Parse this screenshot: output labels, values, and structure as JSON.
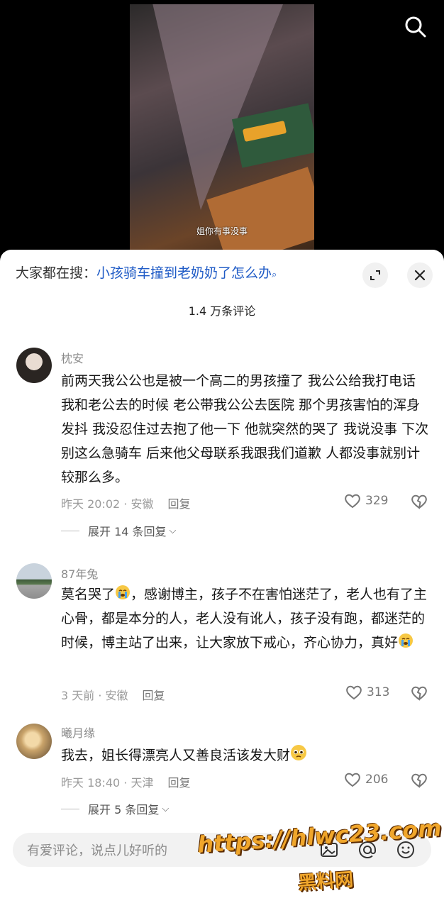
{
  "video": {
    "subtitle": "姐你有事没事"
  },
  "header": {
    "hot_search_prefix": "大家都在搜：",
    "hot_search_query": "小孩骑车撞到老奶奶了怎么办",
    "comment_count": "1.4 万条评论"
  },
  "comments": [
    {
      "username": "枕安",
      "text": "前两天我公公也是被一个高二的男孩撞了  我公公给我打电话  我和老公去的时候 老公带我公公去医院  那个男孩害怕的浑身发抖  我没忍住过去抱了他一下  他就突然的哭了  我说没事  下次别这么急骑车  后来他父母联系我跟我们道歉  人都没事就别计较那么多。",
      "time_location": "昨天 20:02 · 安徽",
      "reply_label": "回复",
      "likes": "329",
      "expand_label": "展开 14 条回复"
    },
    {
      "username": "87年兔",
      "text_part1": "莫名哭了",
      "text_part2": "，感谢博主，孩子不在害怕迷茫了，老人也有了主心骨，都是本分的人，老人没有讹人，孩子没有跑，都迷茫的时候，博主站了出来，让大家放下戒心，齐心协力，真好",
      "time_location": "3 天前 · 安徽",
      "reply_label": "回复",
      "likes": "313"
    },
    {
      "username": "曦月缘",
      "text": "我去，姐长得漂亮人又善良活该发大财",
      "time_location": "昨天 18:40 · 天津",
      "reply_label": "回复",
      "likes": "206",
      "expand_label": "展开 5 条回复"
    }
  ],
  "input": {
    "placeholder": "有爱评论，说点儿好听的"
  },
  "watermark": {
    "url": "https://hlwc23.com",
    "name": "黑料网"
  },
  "colors": {
    "link_blue": "#1f5bc6",
    "watermark_orange": "#f0a62b"
  }
}
